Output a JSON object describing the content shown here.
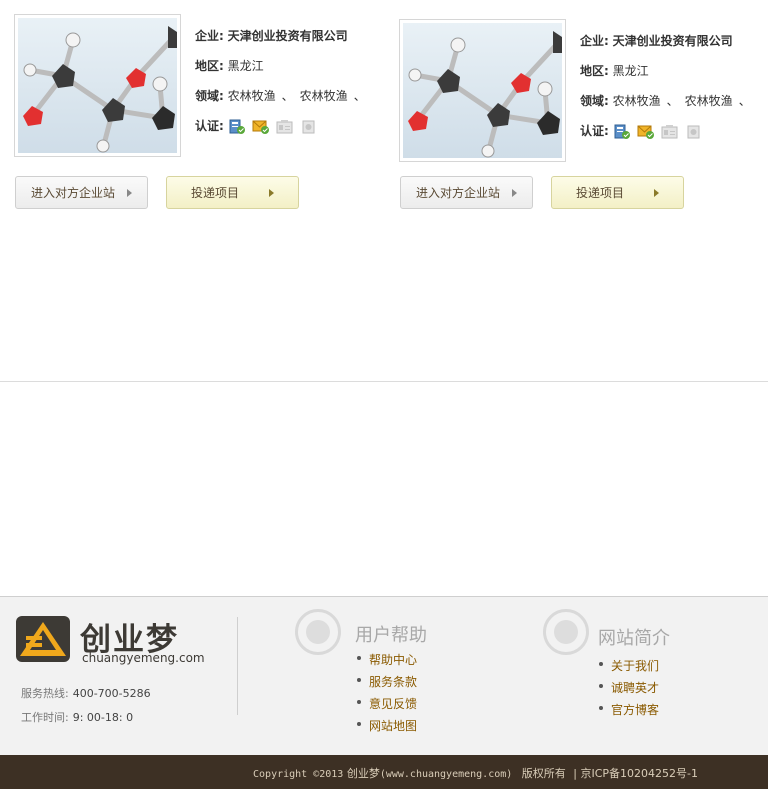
{
  "cards": [
    {
      "company_label": "企业:",
      "company": "天津创业投资有限公司",
      "region_label": "地区:",
      "region": "黑龙江",
      "field_label": "领域:",
      "fields": [
        "农林牧渔",
        "农林牧渔"
      ],
      "field_sep": "、",
      "cert_label": "认证:",
      "cert_icons": [
        "id-verified-icon",
        "email-verified-icon",
        "business-card-icon",
        "license-icon"
      ],
      "enter_label": "进入对方企业站",
      "invest_label": "投递项目"
    },
    {
      "company_label": "企业:",
      "company": "天津创业投资有限公司",
      "region_label": "地区:",
      "region": "黑龙江",
      "field_label": "领域:",
      "fields": [
        "农林牧渔",
        "农林牧渔"
      ],
      "field_sep": "、",
      "cert_label": "认证:",
      "cert_icons": [
        "id-verified-icon",
        "email-verified-icon",
        "business-card-icon",
        "license-icon"
      ],
      "enter_label": "进入对方企业站",
      "invest_label": "投递项目"
    }
  ],
  "footer": {
    "brand": "创业梦",
    "domain": "chuangyemeng.com",
    "hotline_label": "服务热线:",
    "hotline": "400-700-5286",
    "hours_label": "工作时间:",
    "hours": "9: 00-18: 0",
    "help": {
      "title": "用户帮助",
      "links": [
        "帮助中心",
        "服务条款",
        "意见反馈",
        "网站地图"
      ]
    },
    "about": {
      "title": "网站简介",
      "links": [
        "关于我们",
        "诚聘英才",
        "官方博客"
      ]
    },
    "copyright_prefix": "Copyright ©2013",
    "copyright_brand": "创业梦",
    "copyright_domain": "(www.chuangyemeng.com)",
    "copyright_rights": "版权所有",
    "icp": "| 京ICP备10204252号-1"
  },
  "colors": {
    "footer_bar": "#3d3024",
    "link": "#8a5a00",
    "invest_button": "#f3f0c6"
  }
}
